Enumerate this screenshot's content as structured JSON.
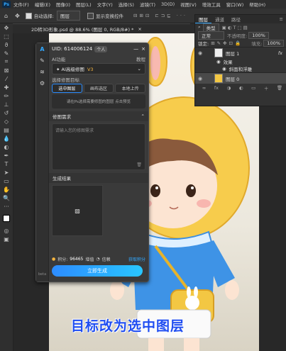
{
  "menubar": {
    "app_icon": "Ps",
    "items": [
      "文件(F)",
      "编辑(E)",
      "图像(I)",
      "图层(L)",
      "文字(Y)",
      "选择(S)",
      "滤镜(T)",
      "3D(D)",
      "视图(V)",
      "增效工具",
      "窗口(W)",
      "帮助(H)"
    ]
  },
  "options_bar": {
    "auto_select_label": "自动选择:",
    "auto_select_value": "图层",
    "transform_label": "显示变换控件"
  },
  "document_tab": {
    "title": "2D转3D形象.psd @ 88.6% (图层 0, RGB/8#) *",
    "close": "×"
  },
  "layers_panel": {
    "tabs": [
      "图层",
      "通道",
      "路径"
    ],
    "kind_label": "类型",
    "blend_mode": "正常",
    "opacity_label": "不透明度:",
    "opacity_value": "100%",
    "lock_label": "锁定:",
    "fill_label": "填充:",
    "fill_value": "100%",
    "layers": [
      {
        "name": "图层 1",
        "fx": "fx"
      },
      {
        "name": "效果",
        "fx": ""
      },
      {
        "name": "斜面和浮雕",
        "fx": ""
      },
      {
        "name": "图层 0",
        "fx": ""
      }
    ]
  },
  "plugin": {
    "uid_label": "UID: 614006124",
    "user_badge": "个人",
    "ai_label": "AI功能",
    "tutorial_label": "教程",
    "mode_value": "AI高级修图",
    "mode_badge": "V3",
    "target_label": "选择修图目标",
    "target_options": [
      "选中图层",
      "画布选区",
      "本地上传"
    ],
    "hint_text": "请在Ps选择需要修图的图层 点击预览",
    "req_title": "修图需求",
    "req_placeholder": "请输入您的修图需求",
    "result_title": "生成结果",
    "points_label": "积分:",
    "points_value": "96465",
    "recharge_label": "增值",
    "credit_label": "信赖",
    "get_points_label": "获取积分",
    "generate_label": "立即生成",
    "side_version": "beta"
  },
  "caption": "目标改为选中图层",
  "colors": {
    "accent": "#2d8cff",
    "caption": "#1f4df1"
  }
}
